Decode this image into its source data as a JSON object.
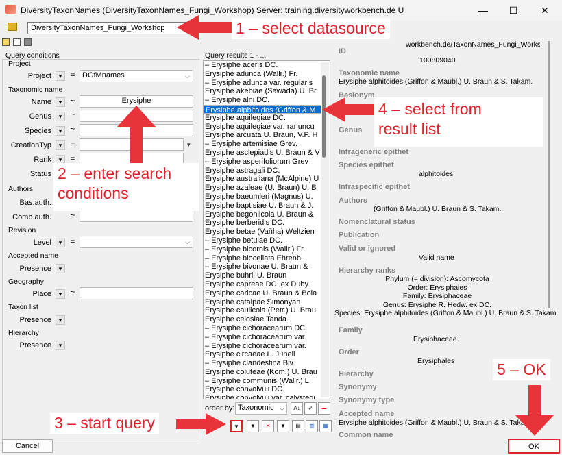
{
  "window": {
    "app_name": "DiversityTaxonNames",
    "title_rest": "   (DiversityTaxonNames_Fungi_Workshop)    Server: training.diversityworkbench.de    User: Worksh...",
    "minimize": "—",
    "maximize": "☐",
    "close": "✕"
  },
  "datasource": {
    "value": "DiversityTaxonNames_Fungi_Workshop",
    "url_fragment": "workbench.de/TaxonNames_Fungi_Worksh"
  },
  "query": {
    "header": "Query conditions",
    "groups": {
      "project": "Project",
      "taxonomic": "Taxonomic name",
      "authors": "Authors",
      "revision": "Revision",
      "accepted": "Accepted name",
      "geography": "Geography",
      "taxonlist": "Taxon list",
      "hierarchy": "Hierarchy"
    },
    "fields": {
      "project_label": "Project",
      "project_value": "DGfMnames",
      "name_label": "Name",
      "name_value": "Erysiphe",
      "genus_label": "Genus",
      "species_label": "Species",
      "creation_label": "CreationTyp",
      "rank_label": "Rank",
      "status_label": "Status",
      "basauth_label": "Bas.auth.",
      "combauth_label": "Comb.auth.",
      "level_label": "Level",
      "presence_label": "Presence",
      "place_label": "Place"
    },
    "eq": "=",
    "tilde": "~",
    "dd": "▾"
  },
  "results": {
    "header": "Query results   1 - ...",
    "items": [
      "–    Erysiphe aceris DC.",
      "Erysiphe adunca (Wallr.) Fr.",
      "–    Erysiphe adunca var. regularis",
      "Erysiphe akebiae (Sawada) U. Br",
      "–    Erysiphe alni DC.",
      "Erysiphe alphitoides (Griffon & M",
      "Erysiphe aquilegiae DC.",
      "Erysiphe aquilegiae var. ranuncu",
      "Erysiphe arcuata U. Braun, V.P. H",
      "–    Erysiphe artemisiae Grev.",
      "Erysiphe asclepiadis U. Braun & V",
      "–    Erysiphe asperifoliorum Grev",
      "Erysiphe astragali DC.",
      "Erysiphe australiana (McAlpine) U",
      "Erysiphe azaleae (U. Braun) U. B",
      "Erysiphe baeumleri (Magnus) U.",
      "Erysiphe baptisiae U. Braun & J.",
      "Erysiphe begoniicola U. Braun &",
      "Erysiphe berberidis DC.",
      "Erysiphe betae (Vaňha) Weltzien",
      "–    Erysiphe betulae DC.",
      "–    Erysiphe bicornis (Wallr.) Fr.",
      "–    Erysiphe biocellata Ehrenb.",
      "–    Erysiphe bivonae U. Braun &",
      "Erysiphe buhrii U. Braun",
      "Erysiphe capreae DC. ex Duby",
      "Erysiphe caricae U. Braun & Bola",
      "Erysiphe catalpae Simonyan",
      "Erysiphe caulicola (Petr.) U. Brau",
      "Erysiphe celosiae Tanda",
      "–    Erysiphe cichoracearum DC.",
      "–    Erysiphe cichoracearum var.",
      "–    Erysiphe cichoracearum var.",
      "Erysiphe circaeae L. Junell",
      "–    Erysiphe clandestina Biv.",
      "Erysiphe coluteae (Kom.) U. Brau",
      "–    Erysiphe communis (Wallr.) L",
      "Erysiphe convolvuli DC.",
      "Erysiphe convolvuli var. calystegi"
    ],
    "order_label": "order by:",
    "order_value": "Taxonomic"
  },
  "detail": {
    "id_label": "ID",
    "id_value": "100809040",
    "taxname_label": "Taxonomic name",
    "taxname_value": "Erysiphe alphitoides (Griffon & Maubl.) U. Braun & S. Takam.",
    "basionym_label": "Basionym",
    "rank_label": "Rank",
    "genus_label": "Genus",
    "infragen_label": "Infrageneric epithet",
    "species_label": "Species epithet",
    "species_value": "alphitoides",
    "infraspec_label": "Infraspecific epithet",
    "authors_label": "Authors",
    "authors_value": "(Griffon & Maubl.) U. Braun & S. Takam.",
    "nomstat_label": "Nomenclatural status",
    "publication_label": "Publication",
    "valid_label": "Valid or ignored",
    "valid_value": "Valid name",
    "hier_label": "Hierarchy ranks",
    "hier_lines": [
      "Phylum (= division):  Ascomycota",
      "Order:  Erysiphales",
      "Family:  Erysiphaceae",
      "Genus:  Erysiphe R. Hedw. ex DC.",
      "Species:  Erysiphe alphitoides (Griffon & Maubl.) U. Braun & S. Takam."
    ],
    "family_label": "Family",
    "family_value": "Erysiphaceae",
    "order_label": "Order",
    "order_value": "Erysiphales",
    "hierarchy_label": "Hierarchy",
    "synonymy_label": "Synonymy",
    "syntype_label": "Synonymy type",
    "accepted_label": "Accepted name",
    "accepted_value": "Erysiphe alphitoides (Griffon & Maubl.) U. Braun & S. Takam.",
    "common_label": "Common name"
  },
  "buttons": {
    "cancel": "Cancel",
    "ok": "OK"
  },
  "annotations": {
    "a1": "1 – select datasource",
    "a2_line1": "2 – enter search",
    "a2_line2": "conditions",
    "a3": "3 – start query",
    "a4_line1": "4 – select from",
    "a4_line2": "result list",
    "a5": "5 – OK"
  },
  "colors": {
    "annotation": "#e0202a",
    "selection": "#0a6ed1"
  }
}
